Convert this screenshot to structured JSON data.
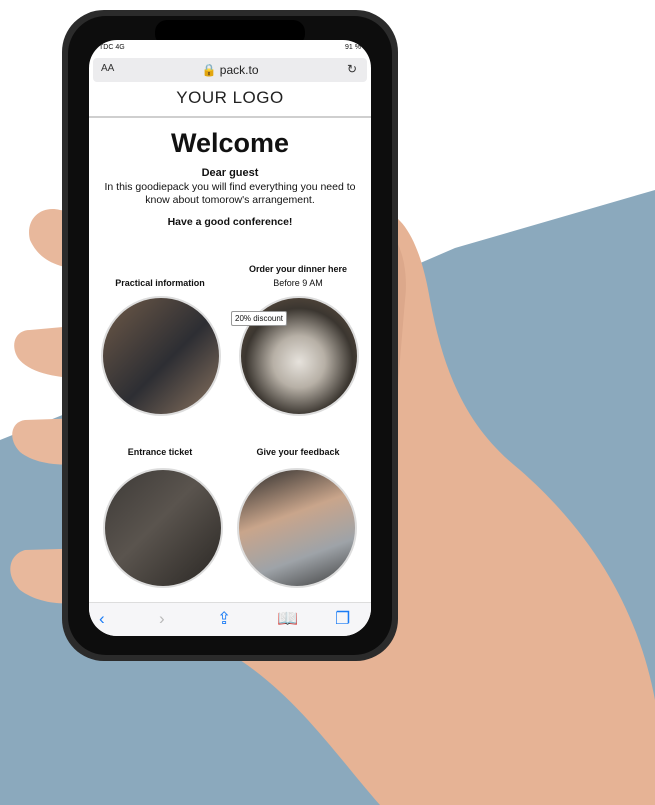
{
  "colors": {
    "accent": "#1a7cf5",
    "background_blue": "#8ba9bd",
    "skin": "#e8b89c"
  },
  "status_bar": {
    "carrier": "TDC 4G",
    "battery": "91 %"
  },
  "browser": {
    "text_size_label": "AA",
    "url": "pack.to",
    "lock_icon": "lock-icon",
    "reload_icon": "reload-icon"
  },
  "page": {
    "logo": "YOUR LOGO",
    "welcome": "Welcome",
    "greeting": "Dear guest",
    "intro": "In this goodiepack you will find everything you need to know about tomorow's arrangement.",
    "closing": "Have a good conference!"
  },
  "tiles": [
    {
      "label": "Practical information",
      "sub": ""
    },
    {
      "label": "Order your dinner here",
      "sub": "Before 9 AM",
      "badge": "20% discount"
    },
    {
      "label": "Entrance ticket",
      "sub": ""
    },
    {
      "label": "Give your feedback",
      "sub": ""
    }
  ],
  "toolbar": {
    "back": "back-icon",
    "forward": "forward-icon",
    "share": "share-icon",
    "bookmarks": "bookmarks-icon",
    "tabs": "tabs-icon"
  }
}
